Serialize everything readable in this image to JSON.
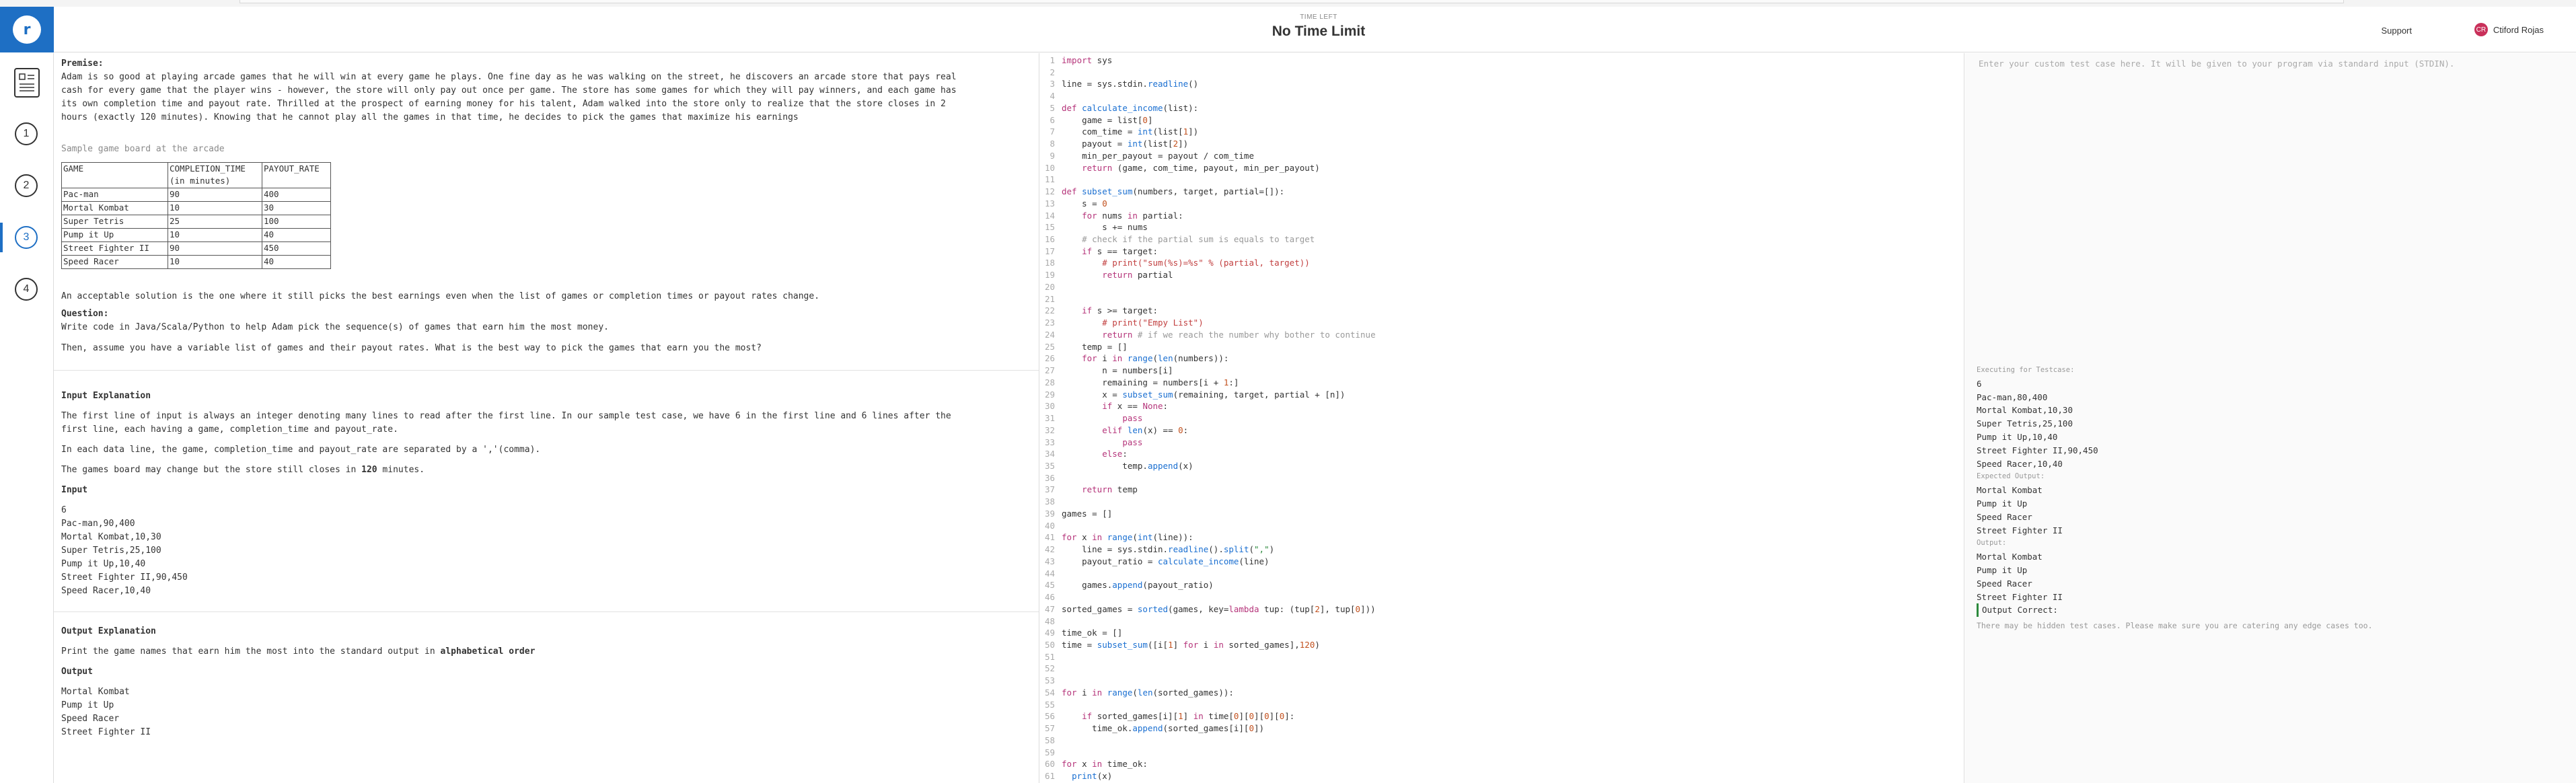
{
  "header": {
    "timer_label": "TIME LEFT",
    "timer_value": "No Time Limit",
    "support_label": "Support",
    "user_initials": "CR",
    "user_name": "Ctiford Rojas"
  },
  "sidebar": {
    "steps": [
      "1",
      "2",
      "3",
      "4"
    ],
    "active_step": "3"
  },
  "problem": {
    "premise_heading": "Premise:",
    "premise_lines": [
      "Adam is so good at playing arcade games that he will win at every game he plays. One fine day as he was walking on the street, he discovers an arcade store that pays real",
      "cash for every game that the player wins - however, the store will only pay out once per game. The store has some games for which they will pay winners, and each game has",
      "its own completion time and payout rate. Thrilled at the prospect of earning money for his talent, Adam walked into the store only to realize that the store closes in 2",
      "hours (exactly 120 minutes). Knowing that he cannot play all the games in that time, he decides to pick the games that maximize his earnings"
    ],
    "board_caption": "Sample game board at the arcade",
    "board_headers": [
      "GAME",
      "COMPLETION_TIME\n(in minutes)",
      "PAYOUT_RATE"
    ],
    "board_header_col2_line1": "COMPLETION_TIME",
    "board_header_col2_line2": "(in minutes)",
    "board_rows": [
      [
        "Pac-man",
        "90",
        "400"
      ],
      [
        "Mortal Kombat",
        "10",
        "30"
      ],
      [
        "Super Tetris",
        "25",
        "100"
      ],
      [
        "Pump it Up",
        "10",
        "40"
      ],
      [
        "Street Fighter II",
        "90",
        "450"
      ],
      [
        "Speed Racer",
        "10",
        "40"
      ]
    ],
    "acceptable": "An acceptable solution is the one where it still picks the best earnings even when the list of games or completion times or payout rates change.",
    "question_heading": "Question:",
    "question_line1": "Write code in Java/Scala/Python to help Adam pick the sequence(s) of games that earn him the most money.",
    "question_line2": "Then, assume you have a variable list of games and their payout rates. What is the best way to pick the games that earn you the most?",
    "input_expl_heading": "Input Explanation",
    "input_expl_lines": [
      "The first line of input is always an integer denoting many lines to read after the first line. In our sample test case, we have 6 in the first line and 6 lines after the",
      "first line, each having a game, completion_time and payout_rate."
    ],
    "input_expl_sep": "In each data line, the game, completion_time and payout_rate are separated by a ','(comma).",
    "input_expl_change_prefix": "The games board may change but the store still closes in ",
    "input_expl_change_bold": "120",
    "input_expl_change_suffix": " minutes.",
    "input_heading": "Input",
    "input_lines": [
      "6",
      "Pac-man,90,400",
      "Mortal Kombat,10,30",
      "Super Tetris,25,100",
      "Pump it Up,10,40",
      "Street Fighter II,90,450",
      "Speed Racer,10,40"
    ],
    "output_expl_heading": "Output Explanation",
    "output_expl_prefix": "Print the game names that earn him the most into the standard output in ",
    "output_expl_bold": "alphabetical order",
    "output_heading": "Output",
    "output_lines": [
      "Mortal Kombat",
      "Pump it Up",
      "Speed Racer",
      "Street Fighter II"
    ]
  },
  "editor": {
    "code_lines": [
      "import sys",
      "",
      "line = sys.stdin.readline()",
      "",
      "def calculate_income(list):",
      "    game = list[0]",
      "    com_time = int(list[1])",
      "    payout = int(list[2])",
      "    min_per_payout = payout / com_time",
      "    return (game, com_time, payout, min_per_payout)",
      "",
      "def subset_sum(numbers, target, partial=[]):",
      "    s = 0",
      "    for nums in partial:",
      "        s += nums",
      "    # check if the partial sum is equals to target",
      "    if s == target:",
      "        # print(\"sum(%s)=%s\" % (partial, target))",
      "        return partial",
      "",
      "",
      "    if s >= target:",
      "        # print(\"Empy List\")",
      "        return # if we reach the number why bother to continue",
      "    temp = []",
      "    for i in range(len(numbers)):",
      "        n = numbers[i]",
      "        remaining = numbers[i + 1:]",
      "        x = subset_sum(remaining, target, partial + [n])",
      "        if x == None:",
      "            pass",
      "        elif len(x) == 0:",
      "            pass",
      "        else:",
      "            temp.append(x)",
      "",
      "    return temp",
      "",
      "games = []",
      "",
      "for x in range(int(line)):",
      "    line = sys.stdin.readline().split(\",\")",
      "    payout_ratio = calculate_income(line)",
      "",
      "    games.append(payout_ratio)",
      "",
      "sorted_games = sorted(games, key=lambda tup: (tup[2], tup[0]))",
      "",
      "time_ok = []",
      "time = subset_sum([i[1] for i in sorted_games],120)",
      "",
      "",
      "",
      "for i in range(len(sorted_games)):",
      "",
      "    if sorted_games[i][1] in time[0][0][0][0]:",
      "      time_ok.append(sorted_games[i][0])",
      "",
      "",
      "for x in time_ok:",
      "  print(x)",
      ""
    ]
  },
  "stdin": {
    "placeholder": "Enter your custom test case here. It will be given to your program via standard input (STDIN)."
  },
  "results": {
    "executing_label": "Executing for Testcase:",
    "testcase_lines": [
      "6",
      "Pac-man,80,400",
      "Mortal Kombat,10,30",
      "Super Tetris,25,100",
      "Pump it Up,10,40",
      "Street Fighter II,90,450",
      "Speed Racer,10,40"
    ],
    "expected_label": "Expected Output:",
    "expected_lines": [
      "Mortal Kombat",
      "Pump it Up",
      "Speed Racer",
      "Street Fighter II"
    ],
    "output_label": "Output:",
    "output_lines": [
      "Mortal Kombat",
      "Pump it Up",
      "Speed Racer",
      "Street Fighter II"
    ],
    "status": "Output Correct:",
    "note": "There may be hidden test cases. Please make sure you are catering any edge cases too."
  },
  "colors": {
    "brand": "#1e6fc4",
    "keyword": "#b5347a",
    "function": "#1a6fd1",
    "number": "#c2511e",
    "string": "#2c8a3c",
    "success": "#2c8a3c"
  }
}
